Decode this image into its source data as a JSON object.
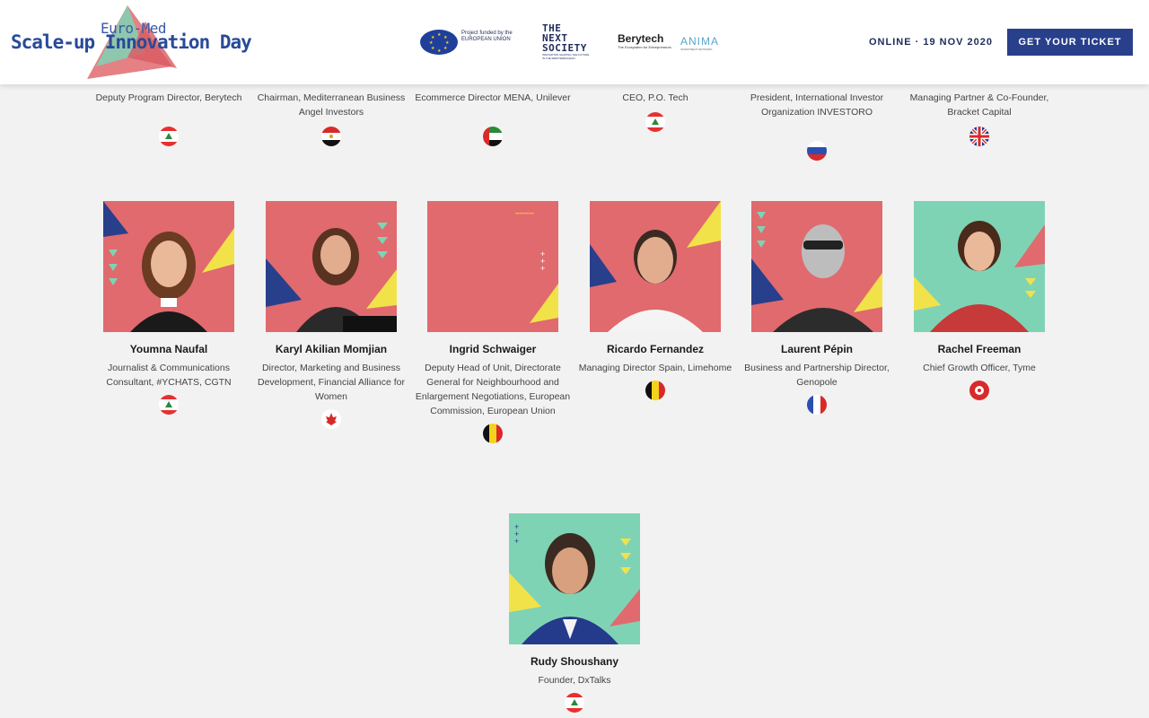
{
  "brand": {
    "logo_top": "Euro-Med",
    "logo_main": "Scale-up Innovation Day"
  },
  "partners": {
    "eu_text": "Project funded by the EUROPEAN UNION",
    "next_society": "THE NEXT SOCIETY",
    "next_society_tagline": "INNOVATION SHAPING THE FUTURE IN THE MEDITERRANEAN",
    "berytech": "Berytech",
    "berytech_tagline": "The Ecosystem for Entrepreneurs",
    "anima": "ANIMA",
    "anima_tagline": "INVESTMENT NETWORK"
  },
  "event": {
    "date_label": "ONLINE · 19 NOV 2020",
    "ticket_label": "GET YOUR TICKET"
  },
  "speakers_top": [
    {
      "role": "Deputy Program Director, Berytech",
      "flag": "lebanon"
    },
    {
      "role": "Chairman, Mediterranean Business Angel Investors",
      "flag": "egypt"
    },
    {
      "role": "Ecommerce Director MENA, Unilever",
      "flag": "uae"
    },
    {
      "role": "CEO, P.O. Tech",
      "flag": "lebanon"
    },
    {
      "role": "President, International Investor Organization INVESTORO",
      "flag": "russia"
    },
    {
      "role": "Managing Partner & Co-Founder, Bracket Capital",
      "flag": "uk"
    }
  ],
  "speakers": [
    {
      "name": "Youmna Naufal",
      "role": "Journalist & Communications Consultant, #YCHATS, CGTN",
      "flag": "lebanon",
      "bg": "#e06a6e"
    },
    {
      "name": "Karyl Akilian Momjian",
      "role": "Director, Marketing and Business Development, Financial Alliance for Women",
      "flag": "canada",
      "bg": "#e06a6e"
    },
    {
      "name": "Ingrid Schwaiger",
      "role": "Deputy Head of Unit, Directorate General for Neighbourhood and Enlargement Negotiations, European Commission, European Union",
      "flag": "belgium",
      "bg": "#e06a6e"
    },
    {
      "name": "Ricardo Fernandez",
      "role": "Managing Director Spain, Limehome",
      "flag": "belgium",
      "bg": "#e06a6e"
    },
    {
      "name": "Laurent Pépin",
      "role": "Business and Partnership Director, Genopole",
      "flag": "france",
      "bg": "#e06a6e"
    },
    {
      "name": "Rachel Freeman",
      "role": "Chief Growth Officer, Tyme",
      "flag": "hongkong",
      "bg": "#7fd3b5"
    },
    {
      "name": "Rudy Shoushany",
      "role": "Founder, DxTalks",
      "flag": "lebanon",
      "bg": "#7fd3b5"
    }
  ],
  "colors": {
    "navy": "#283f8c",
    "coral": "#e06a6e",
    "mint": "#7fd3b5",
    "yellow": "#f2e24a"
  }
}
